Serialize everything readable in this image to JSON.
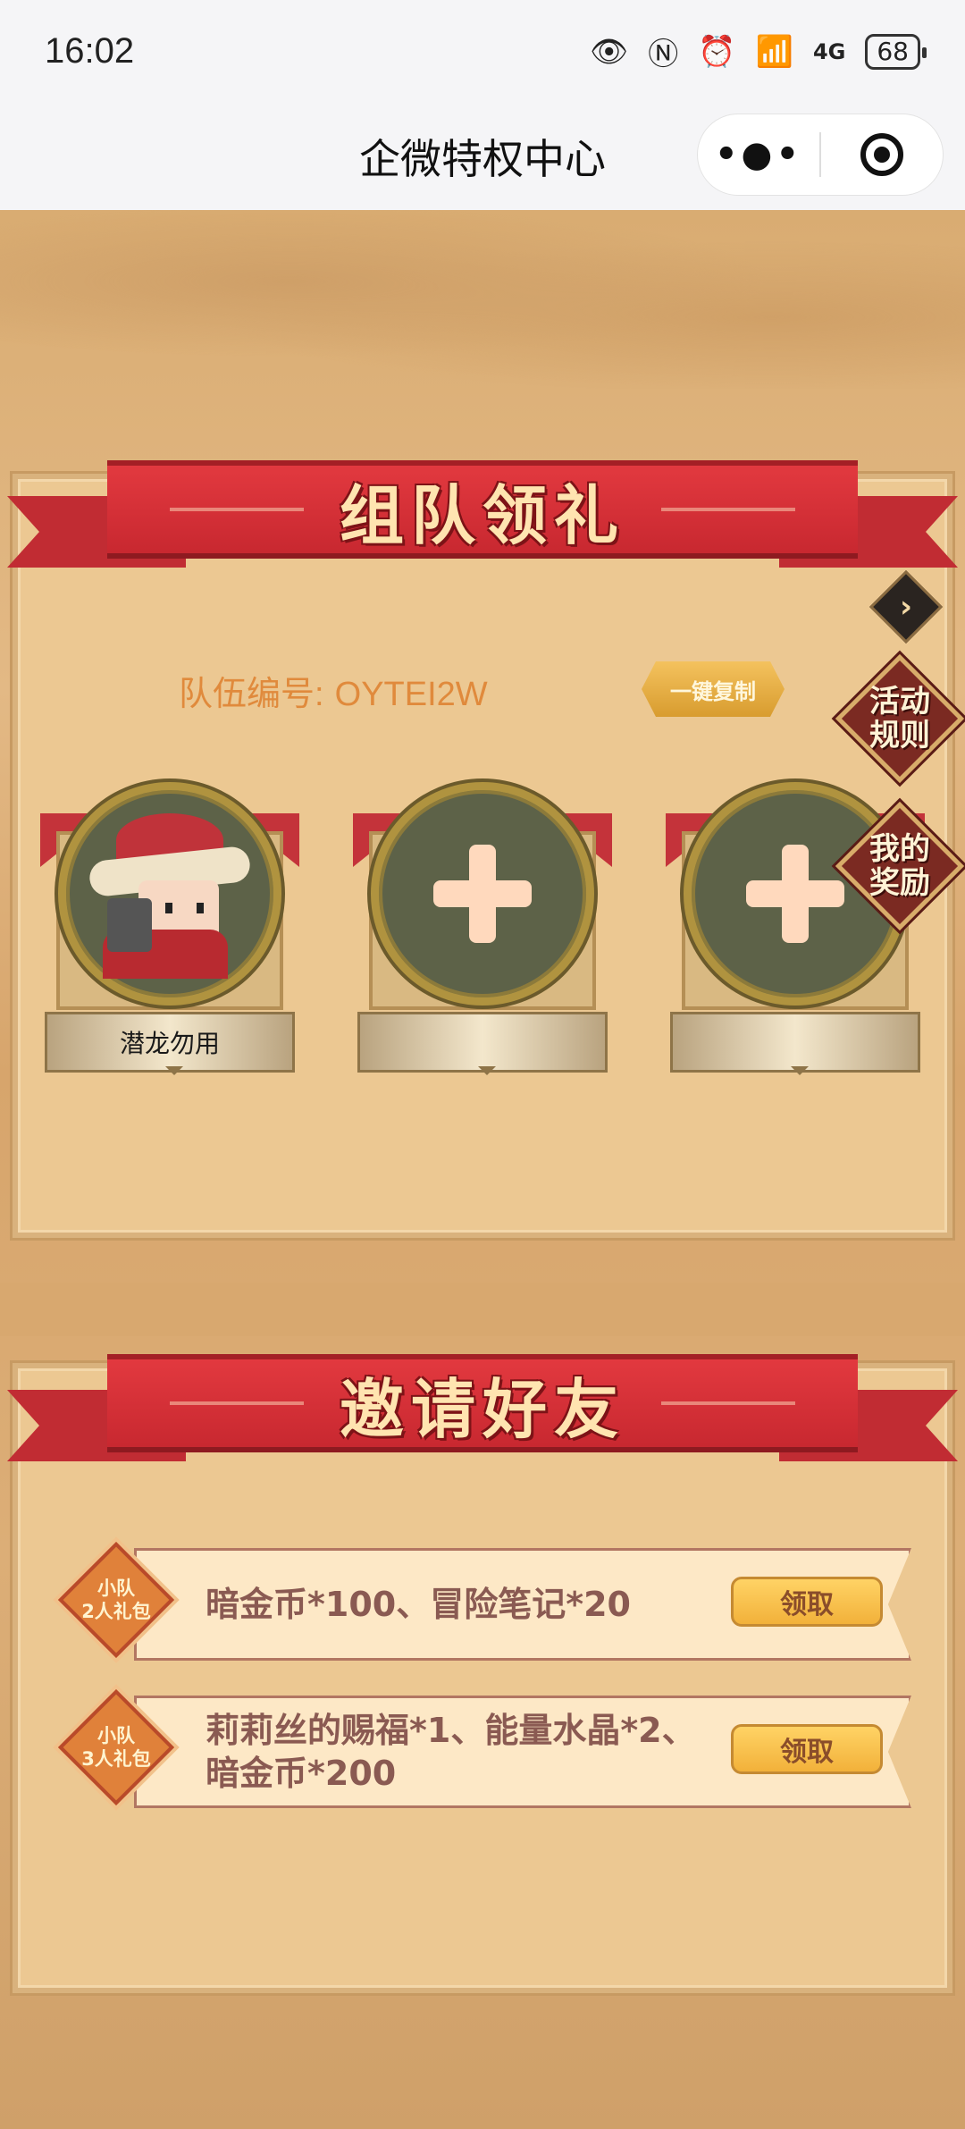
{
  "status_bar": {
    "time": "16:02",
    "network": "4G",
    "battery": "68"
  },
  "nav": {
    "title": "企微特权中心",
    "more_icon": "more-dots-icon",
    "close_icon": "target-circle-icon"
  },
  "team_section": {
    "title": "组队领礼",
    "team_id_label": "队伍编号:",
    "team_id_value": "OYTEI2W",
    "copy_label": "一键复制",
    "side_rules": "活动\n规则",
    "side_rewards": "我的\n奖励",
    "members": [
      {
        "name": "潜龙勿用",
        "filled": true
      },
      {
        "name": "",
        "filled": false
      },
      {
        "name": "",
        "filled": false
      }
    ]
  },
  "invite_section": {
    "title": "邀请好友",
    "rewards": [
      {
        "badge": "小队\n2人礼包",
        "description": "暗金币*100、冒险笔记*20",
        "button": "领取"
      },
      {
        "badge": "小队\n3人礼包",
        "description": "莉莉丝的赐福*1、能量水晶*2、暗金币*200",
        "button": "领取"
      }
    ]
  },
  "colors": {
    "ribbon_red": "#d6333a",
    "title_gold": "#ffe4b0",
    "accent_orange": "#e08a3c",
    "button_yellow": "#f2b13a"
  }
}
